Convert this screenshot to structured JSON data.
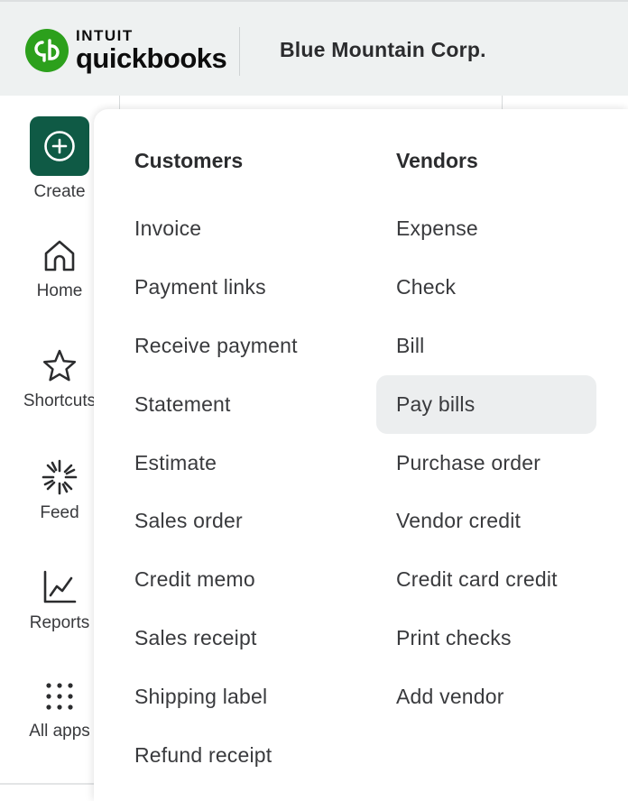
{
  "header": {
    "logo_brand": "INTUIT",
    "logo_product": "quickbooks",
    "company_name": "Blue Mountain Corp."
  },
  "sidebar": {
    "items": [
      {
        "label": "Create",
        "icon": "plus-circle-icon"
      },
      {
        "label": "Home",
        "icon": "home-icon"
      },
      {
        "label": "Shortcuts",
        "icon": "star-icon"
      },
      {
        "label": "Feed",
        "icon": "sparkle-icon"
      },
      {
        "label": "Reports",
        "icon": "line-chart-icon"
      },
      {
        "label": "All apps",
        "icon": "grid-dots-icon"
      }
    ]
  },
  "create_menu": {
    "customers": {
      "heading": "Customers",
      "items": [
        "Invoice",
        "Payment links",
        "Receive payment",
        "Statement",
        "Estimate",
        "Sales order",
        "Credit memo",
        "Sales receipt",
        "Shipping label",
        "Refund receipt"
      ]
    },
    "vendors": {
      "heading": "Vendors",
      "items": [
        "Expense",
        "Check",
        "Bill",
        "Pay bills",
        "Purchase order",
        "Vendor credit",
        "Credit card credit",
        "Print checks",
        "Add vendor"
      ],
      "highlighted": "Pay bills"
    }
  },
  "colors": {
    "brand_green": "#2ca01c",
    "create_button": "#0f5a45",
    "hover_bg": "#eceeef"
  }
}
